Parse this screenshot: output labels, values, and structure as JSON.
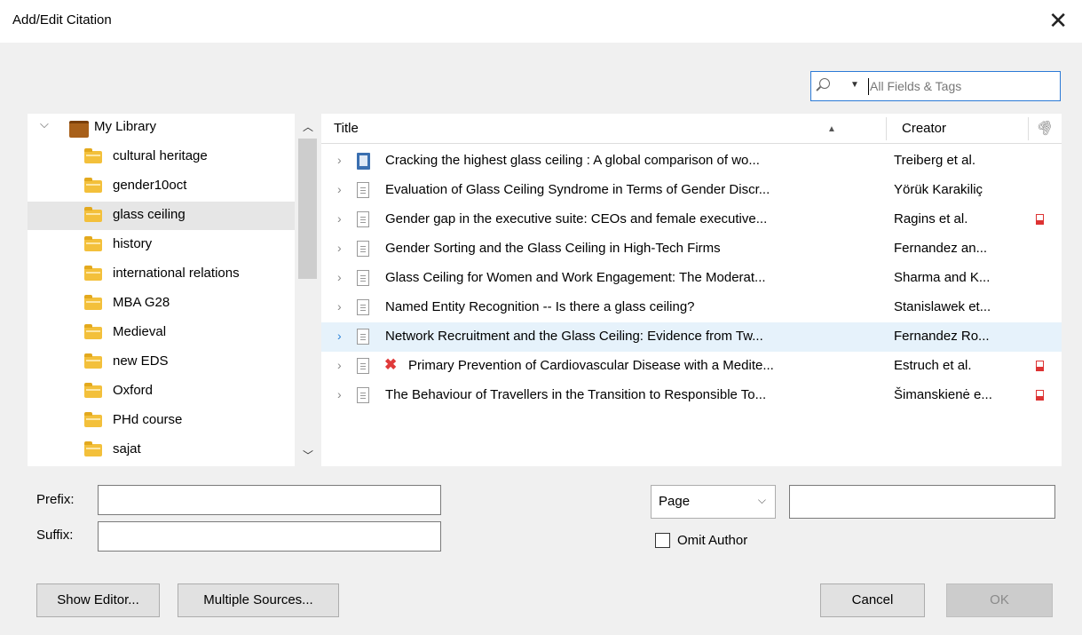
{
  "window": {
    "title": "Add/Edit Citation",
    "close_glyph": "✕"
  },
  "search": {
    "placeholder": "All Fields & Tags",
    "icon": "search-icon"
  },
  "library": {
    "root_label": "My Library",
    "collections": [
      {
        "label": "cultural heritage"
      },
      {
        "label": "gender10oct"
      },
      {
        "label": "glass ceiling",
        "selected": true
      },
      {
        "label": "history"
      },
      {
        "label": "international relations"
      },
      {
        "label": "MBA G28"
      },
      {
        "label": "Medieval"
      },
      {
        "label": "new EDS"
      },
      {
        "label": "Oxford"
      },
      {
        "label": "PHd course"
      },
      {
        "label": "sajat"
      }
    ]
  },
  "items": {
    "columns": {
      "title": "Title",
      "creator": "Creator"
    },
    "rows": [
      {
        "title": "Cracking the highest glass ceiling : A global comparison of wo...",
        "creator": "Treiberg et al.",
        "type": "book",
        "pdf": false,
        "error": false
      },
      {
        "title": "Evaluation of Glass Ceiling Syndrome in Terms of Gender Discr...",
        "creator": "Yörük Karakiliç",
        "type": "document",
        "pdf": false,
        "error": false
      },
      {
        "title": "Gender gap in the executive suite: CEOs and female executive...",
        "creator": "Ragins et al.",
        "type": "document",
        "pdf": true,
        "error": false
      },
      {
        "title": "Gender Sorting and the Glass Ceiling in High-Tech Firms",
        "creator": "Fernandez an...",
        "type": "document",
        "pdf": false,
        "error": false
      },
      {
        "title": "Glass Ceiling for Women and Work Engagement: The Moderat...",
        "creator": "Sharma and K...",
        "type": "document",
        "pdf": false,
        "error": false
      },
      {
        "title": "Named Entity Recognition -- Is there a glass ceiling?",
        "creator": "Stanislawek et...",
        "type": "document",
        "pdf": false,
        "error": false
      },
      {
        "title": "Network Recruitment and the Glass Ceiling: Evidence from Tw...",
        "creator": "Fernandez Ro...",
        "type": "document",
        "pdf": false,
        "error": false,
        "selected": true
      },
      {
        "title": "Primary Prevention of Cardiovascular Disease with a Medite...",
        "creator": "Estruch et al.",
        "type": "document",
        "pdf": true,
        "error": true
      },
      {
        "title": "The Behaviour of Travellers in the Transition to Responsible To...",
        "creator": "Šimanskienė e...",
        "type": "document",
        "pdf": true,
        "error": false
      }
    ]
  },
  "form": {
    "prefix_label": "Prefix:",
    "suffix_label": "Suffix:",
    "prefix_value": "",
    "suffix_value": "",
    "locator_type": "Page",
    "locator_value": "",
    "omit_author_label": "Omit Author",
    "omit_author_checked": false
  },
  "buttons": {
    "show_editor": "Show Editor...",
    "multiple_sources": "Multiple Sources...",
    "cancel": "Cancel",
    "ok": "OK"
  }
}
